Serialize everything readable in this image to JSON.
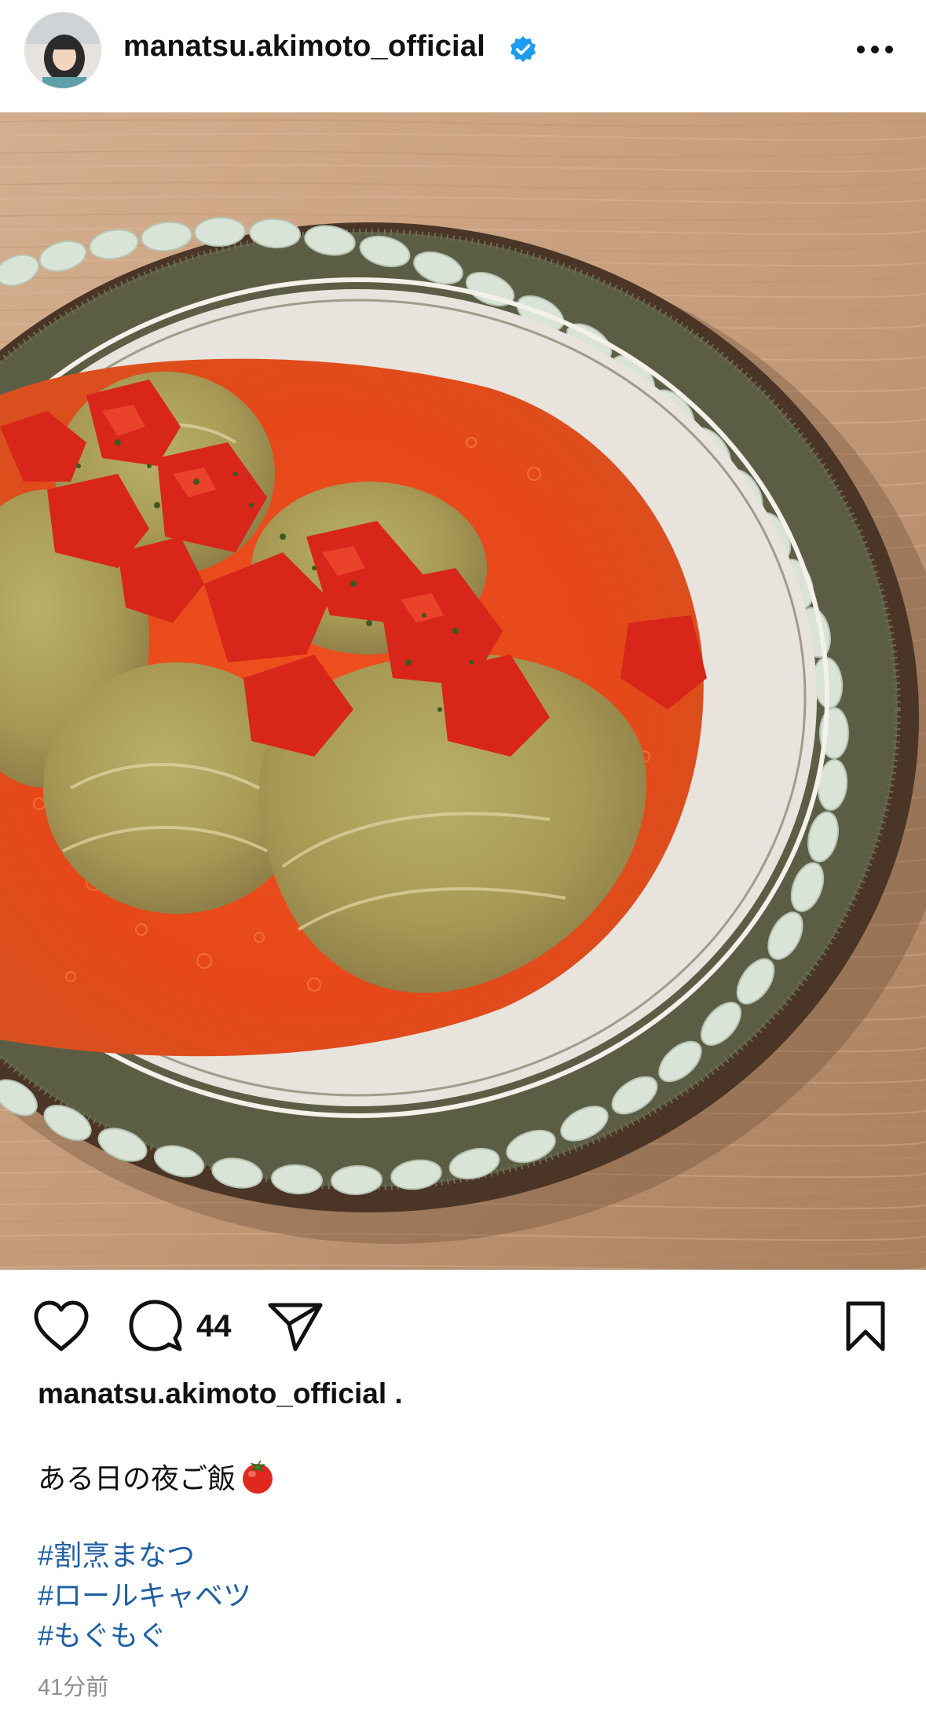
{
  "header": {
    "username": "manatsu.akimoto_official",
    "verified_icon": "verified-badge-icon",
    "more_icon": "more-horizontal-icon"
  },
  "post": {
    "image_icon": "photo",
    "accent_color": "#3897f0"
  },
  "actions": {
    "like_icon": "heart-icon",
    "comment_icon": "comment-icon",
    "comment_count": "44",
    "share_icon": "paper-plane-icon",
    "save_icon": "bookmark-icon"
  },
  "caption": {
    "username": "manatsu.akimoto_official .",
    "text": "ある日の夜ご飯",
    "emoji": "🍅",
    "hashtags": [
      "#割烹まなつ",
      "#ロールキャベツ",
      "#もぐもぐ"
    ],
    "timestamp": "41分前",
    "hashtag_color": "#1f5fa3"
  }
}
